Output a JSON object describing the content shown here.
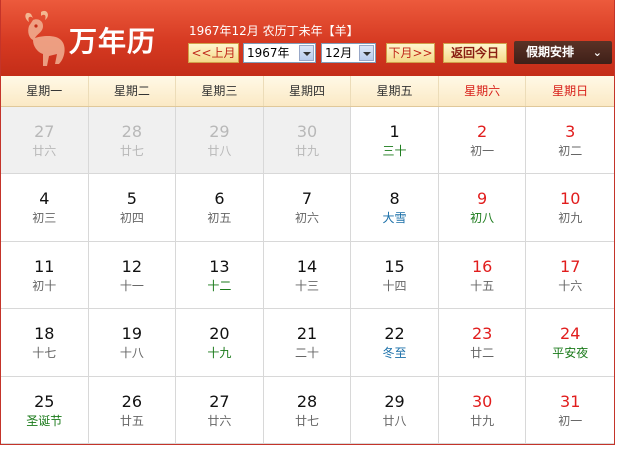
{
  "header": {
    "title": "万年历",
    "year_info": "1967年12月 农历丁未年【羊】",
    "prev_month_label": "<<上月",
    "year_select": "1967年",
    "month_select": "12月",
    "next_month_label": "下月>>",
    "today_label": "返回今日",
    "holiday_label": "假期安排"
  },
  "weekdays": [
    {
      "label": "星期一",
      "weekend": false
    },
    {
      "label": "星期二",
      "weekend": false
    },
    {
      "label": "星期三",
      "weekend": false
    },
    {
      "label": "星期四",
      "weekend": false
    },
    {
      "label": "星期五",
      "weekend": false
    },
    {
      "label": "星期六",
      "weekend": true
    },
    {
      "label": "星期日",
      "weekend": true
    }
  ],
  "days": [
    {
      "day": "27",
      "lunar": "廿六",
      "other_month": true
    },
    {
      "day": "28",
      "lunar": "廿七",
      "other_month": true
    },
    {
      "day": "29",
      "lunar": "廿八",
      "other_month": true
    },
    {
      "day": "30",
      "lunar": "廿九",
      "other_month": true
    },
    {
      "day": "1",
      "lunar": "三十",
      "kind": "festival"
    },
    {
      "day": "2",
      "lunar": "初一",
      "weekend": true
    },
    {
      "day": "3",
      "lunar": "初二",
      "weekend": true
    },
    {
      "day": "4",
      "lunar": "初三"
    },
    {
      "day": "5",
      "lunar": "初四"
    },
    {
      "day": "6",
      "lunar": "初五"
    },
    {
      "day": "7",
      "lunar": "初六"
    },
    {
      "day": "8",
      "lunar": "大雪",
      "kind": "term"
    },
    {
      "day": "9",
      "lunar": "初八",
      "weekend": true,
      "kind": "festival"
    },
    {
      "day": "10",
      "lunar": "初九",
      "weekend": true
    },
    {
      "day": "11",
      "lunar": "初十"
    },
    {
      "day": "12",
      "lunar": "十一"
    },
    {
      "day": "13",
      "lunar": "十二",
      "kind": "festival"
    },
    {
      "day": "14",
      "lunar": "十三"
    },
    {
      "day": "15",
      "lunar": "十四"
    },
    {
      "day": "16",
      "lunar": "十五",
      "weekend": true
    },
    {
      "day": "17",
      "lunar": "十六",
      "weekend": true
    },
    {
      "day": "18",
      "lunar": "十七"
    },
    {
      "day": "19",
      "lunar": "十八"
    },
    {
      "day": "20",
      "lunar": "十九",
      "kind": "festival"
    },
    {
      "day": "21",
      "lunar": "二十"
    },
    {
      "day": "22",
      "lunar": "冬至",
      "kind": "term"
    },
    {
      "day": "23",
      "lunar": "廿二",
      "weekend": true
    },
    {
      "day": "24",
      "lunar": "平安夜",
      "weekend": true,
      "kind": "festival"
    },
    {
      "day": "25",
      "lunar": "圣诞节",
      "kind": "festival"
    },
    {
      "day": "26",
      "lunar": "廿五"
    },
    {
      "day": "27",
      "lunar": "廿六"
    },
    {
      "day": "28",
      "lunar": "廿七"
    },
    {
      "day": "29",
      "lunar": "廿八"
    },
    {
      "day": "30",
      "lunar": "廿九",
      "weekend": true
    },
    {
      "day": "31",
      "lunar": "初一",
      "weekend": true
    }
  ]
}
